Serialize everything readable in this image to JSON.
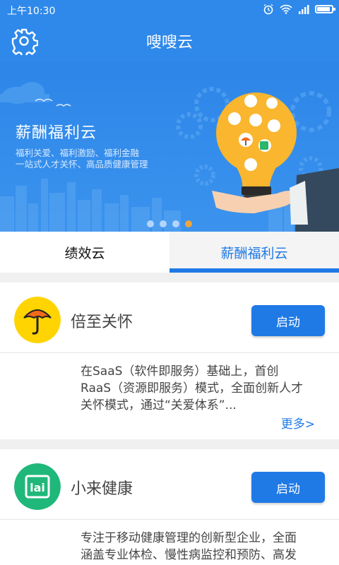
{
  "status_bar": {
    "time": "上午10:30"
  },
  "app_bar": {
    "title": "嗖嗖云"
  },
  "banner": {
    "title": "薪酬福利云",
    "subtitle_line1": "福利关爱、福利激励、福利金融",
    "subtitle_line2": "一站式人才关怀、高品质健康管理",
    "dot_count": 4,
    "active_dot": 4
  },
  "tabs": [
    {
      "label": "绩效云",
      "active": false
    },
    {
      "label": "薪酬福利云",
      "active": true
    }
  ],
  "cards": [
    {
      "name": "倍至关怀",
      "button": "启动",
      "logo_color": "#ffd400",
      "desc_line1": "在SaaS（软件即服务）基础上，首创",
      "desc_line2": "RaaS（资源即服务）模式，全面创新人才",
      "desc_line3": "关怀模式，通过“关爱体系”...",
      "more": "更多>"
    },
    {
      "name": "小来健康",
      "button": "启动",
      "logo_color": "#1fb87a",
      "logo_text": "lai",
      "desc_line1": "专注于移动健康管理的创新型企业，全面",
      "desc_line2": "涵盖专业体检、慢性病监控和预防、高发"
    }
  ],
  "colors": {
    "primary": "#2f89ea",
    "accent": "#1f7ae6",
    "dot_active": "#f0a43a"
  }
}
